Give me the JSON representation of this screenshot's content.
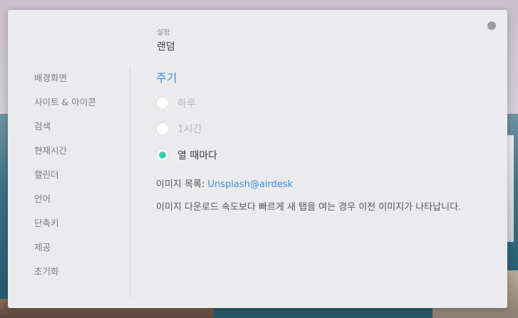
{
  "header": {
    "breadcrumb": "설정",
    "title": "랜덤"
  },
  "sidebar": {
    "items": [
      {
        "label": "배경화면"
      },
      {
        "label": "사이트 & 아이콘"
      },
      {
        "label": "검색"
      },
      {
        "label": "현재시간"
      },
      {
        "label": "캘린더"
      },
      {
        "label": "언어"
      },
      {
        "label": "단축키"
      },
      {
        "label": "제공"
      },
      {
        "label": "초기화"
      }
    ]
  },
  "main": {
    "section_title": "주기",
    "options": [
      {
        "label": "하루",
        "selected": false
      },
      {
        "label": "1시간",
        "selected": false
      },
      {
        "label": "열 때마다",
        "selected": true
      }
    ],
    "source_label": "이미지 목록:",
    "source_link": "Unsplash@airdesk",
    "description": "이미지 다운로드 속도보다 빠르게 새 탭을 여는 경우 이전 이미지가 나타납니다."
  },
  "colors": {
    "accent": "#3a8de0",
    "radio_selected": "#3ccfb0"
  }
}
